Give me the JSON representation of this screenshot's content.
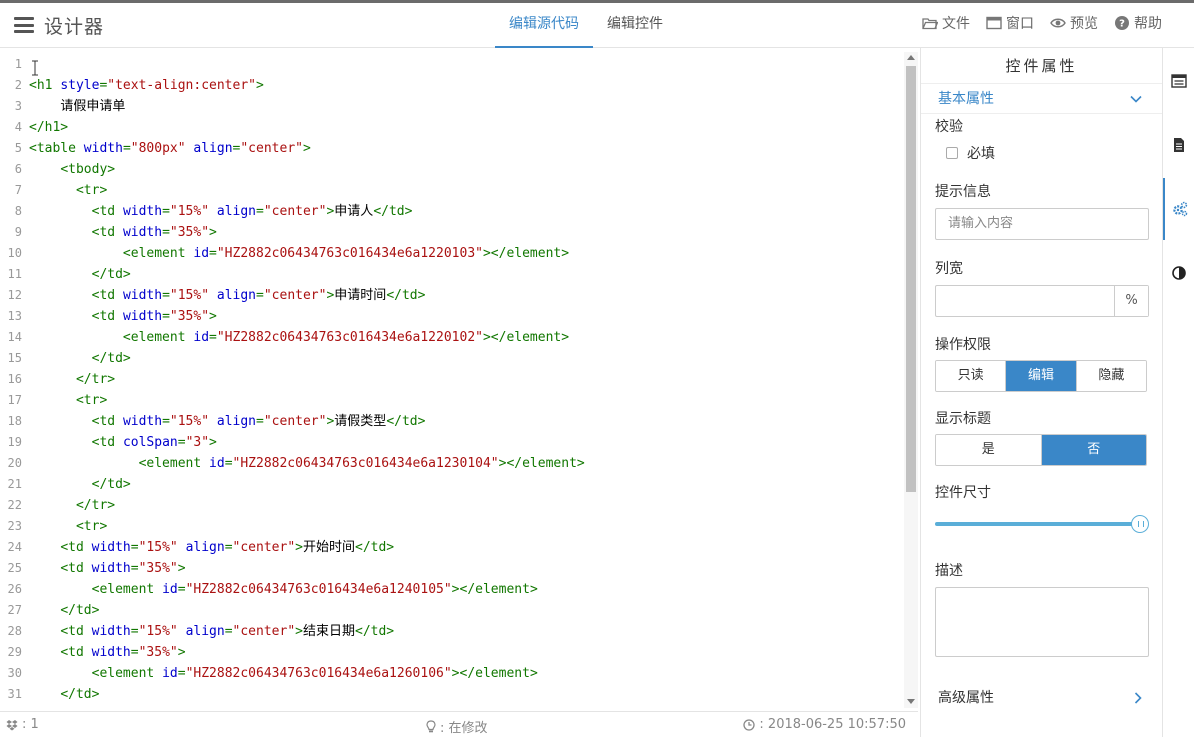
{
  "app": {
    "title": "设计器"
  },
  "tabs": [
    {
      "label": "编辑源代码",
      "active": true
    },
    {
      "label": "编辑控件",
      "active": false
    }
  ],
  "toolbar": {
    "file": "文件",
    "window": "窗口",
    "preview": "预览",
    "help": "帮助"
  },
  "editor": {
    "line_numbers": [
      "1",
      "2",
      "3",
      "4",
      "5",
      "6",
      "7",
      "8",
      "9",
      "10",
      "11",
      "12",
      "13",
      "14",
      "15",
      "16",
      "17",
      "18",
      "19",
      "20",
      "21",
      "22",
      "23",
      "24",
      "25",
      "26",
      "27",
      "28",
      "29",
      "30",
      "31"
    ],
    "lines": [
      {
        "indent": "",
        "tokens": []
      },
      {
        "indent": "",
        "tokens": [
          {
            "t": "tag",
            "v": "<h1"
          },
          {
            "t": "sp",
            "v": " "
          },
          {
            "t": "attr",
            "v": "style"
          },
          {
            "t": "tag",
            "v": "="
          },
          {
            "t": "str",
            "v": "\"text-align:center\""
          },
          {
            "t": "tag",
            "v": ">"
          }
        ]
      },
      {
        "indent": "    ",
        "tokens": [
          {
            "t": "txt",
            "v": "请假申请单"
          }
        ]
      },
      {
        "indent": "",
        "tokens": [
          {
            "t": "tag",
            "v": "</h1>"
          }
        ]
      },
      {
        "indent": "",
        "tokens": [
          {
            "t": "tag",
            "v": "<table"
          },
          {
            "t": "sp",
            "v": " "
          },
          {
            "t": "attr",
            "v": "width"
          },
          {
            "t": "tag",
            "v": "="
          },
          {
            "t": "str",
            "v": "\"800px\""
          },
          {
            "t": "sp",
            "v": " "
          },
          {
            "t": "attr",
            "v": "align"
          },
          {
            "t": "tag",
            "v": "="
          },
          {
            "t": "str",
            "v": "\"center\""
          },
          {
            "t": "tag",
            "v": ">"
          }
        ]
      },
      {
        "indent": "    ",
        "tokens": [
          {
            "t": "tag",
            "v": "<tbody>"
          }
        ]
      },
      {
        "indent": "      ",
        "tokens": [
          {
            "t": "tag",
            "v": "<tr>"
          }
        ]
      },
      {
        "indent": "        ",
        "tokens": [
          {
            "t": "tag",
            "v": "<td"
          },
          {
            "t": "sp",
            "v": " "
          },
          {
            "t": "attr",
            "v": "width"
          },
          {
            "t": "tag",
            "v": "="
          },
          {
            "t": "str",
            "v": "\"15%\""
          },
          {
            "t": "sp",
            "v": " "
          },
          {
            "t": "attr",
            "v": "align"
          },
          {
            "t": "tag",
            "v": "="
          },
          {
            "t": "str",
            "v": "\"center\""
          },
          {
            "t": "tag",
            "v": ">"
          },
          {
            "t": "txt",
            "v": "申请人"
          },
          {
            "t": "tag",
            "v": "</td>"
          }
        ]
      },
      {
        "indent": "        ",
        "tokens": [
          {
            "t": "tag",
            "v": "<td"
          },
          {
            "t": "sp",
            "v": " "
          },
          {
            "t": "attr",
            "v": "width"
          },
          {
            "t": "tag",
            "v": "="
          },
          {
            "t": "str",
            "v": "\"35%\""
          },
          {
            "t": "tag",
            "v": ">"
          }
        ]
      },
      {
        "indent": "            ",
        "tokens": [
          {
            "t": "tag",
            "v": "<element"
          },
          {
            "t": "sp",
            "v": " "
          },
          {
            "t": "attr",
            "v": "id"
          },
          {
            "t": "tag",
            "v": "="
          },
          {
            "t": "str",
            "v": "\"HZ2882c06434763c016434e6a1220103\""
          },
          {
            "t": "tag",
            "v": "></element>"
          }
        ]
      },
      {
        "indent": "        ",
        "tokens": [
          {
            "t": "tag",
            "v": "</td>"
          }
        ]
      },
      {
        "indent": "        ",
        "tokens": [
          {
            "t": "tag",
            "v": "<td"
          },
          {
            "t": "sp",
            "v": " "
          },
          {
            "t": "attr",
            "v": "width"
          },
          {
            "t": "tag",
            "v": "="
          },
          {
            "t": "str",
            "v": "\"15%\""
          },
          {
            "t": "sp",
            "v": " "
          },
          {
            "t": "attr",
            "v": "align"
          },
          {
            "t": "tag",
            "v": "="
          },
          {
            "t": "str",
            "v": "\"center\""
          },
          {
            "t": "tag",
            "v": ">"
          },
          {
            "t": "txt",
            "v": "申请时间"
          },
          {
            "t": "tag",
            "v": "</td>"
          }
        ]
      },
      {
        "indent": "        ",
        "tokens": [
          {
            "t": "tag",
            "v": "<td"
          },
          {
            "t": "sp",
            "v": " "
          },
          {
            "t": "attr",
            "v": "width"
          },
          {
            "t": "tag",
            "v": "="
          },
          {
            "t": "str",
            "v": "\"35%\""
          },
          {
            "t": "tag",
            "v": ">"
          }
        ]
      },
      {
        "indent": "            ",
        "tokens": [
          {
            "t": "tag",
            "v": "<element"
          },
          {
            "t": "sp",
            "v": " "
          },
          {
            "t": "attr",
            "v": "id"
          },
          {
            "t": "tag",
            "v": "="
          },
          {
            "t": "str",
            "v": "\"HZ2882c06434763c016434e6a1220102\""
          },
          {
            "t": "tag",
            "v": "></element>"
          }
        ]
      },
      {
        "indent": "        ",
        "tokens": [
          {
            "t": "tag",
            "v": "</td>"
          }
        ]
      },
      {
        "indent": "      ",
        "tokens": [
          {
            "t": "tag",
            "v": "</tr>"
          }
        ]
      },
      {
        "indent": "      ",
        "tokens": [
          {
            "t": "tag",
            "v": "<tr>"
          }
        ]
      },
      {
        "indent": "        ",
        "tokens": [
          {
            "t": "tag",
            "v": "<td"
          },
          {
            "t": "sp",
            "v": " "
          },
          {
            "t": "attr",
            "v": "width"
          },
          {
            "t": "tag",
            "v": "="
          },
          {
            "t": "str",
            "v": "\"15%\""
          },
          {
            "t": "sp",
            "v": " "
          },
          {
            "t": "attr",
            "v": "align"
          },
          {
            "t": "tag",
            "v": "="
          },
          {
            "t": "str",
            "v": "\"center\""
          },
          {
            "t": "tag",
            "v": ">"
          },
          {
            "t": "txt",
            "v": "请假类型"
          },
          {
            "t": "tag",
            "v": "</td>"
          }
        ]
      },
      {
        "indent": "        ",
        "tokens": [
          {
            "t": "tag",
            "v": "<td"
          },
          {
            "t": "sp",
            "v": " "
          },
          {
            "t": "attr",
            "v": "colSpan"
          },
          {
            "t": "tag",
            "v": "="
          },
          {
            "t": "str",
            "v": "\"3\""
          },
          {
            "t": "tag",
            "v": ">"
          }
        ]
      },
      {
        "indent": "              ",
        "tokens": [
          {
            "t": "tag",
            "v": "<element"
          },
          {
            "t": "sp",
            "v": " "
          },
          {
            "t": "attr",
            "v": "id"
          },
          {
            "t": "tag",
            "v": "="
          },
          {
            "t": "str",
            "v": "\"HZ2882c06434763c016434e6a1230104\""
          },
          {
            "t": "tag",
            "v": "></element>"
          }
        ]
      },
      {
        "indent": "        ",
        "tokens": [
          {
            "t": "tag",
            "v": "</td>"
          }
        ]
      },
      {
        "indent": "      ",
        "tokens": [
          {
            "t": "tag",
            "v": "</tr>"
          }
        ]
      },
      {
        "indent": "      ",
        "tokens": [
          {
            "t": "tag",
            "v": "<tr>"
          }
        ]
      },
      {
        "indent": "    ",
        "tokens": [
          {
            "t": "tag",
            "v": "<td"
          },
          {
            "t": "sp",
            "v": " "
          },
          {
            "t": "attr",
            "v": "width"
          },
          {
            "t": "tag",
            "v": "="
          },
          {
            "t": "str",
            "v": "\"15%\""
          },
          {
            "t": "sp",
            "v": " "
          },
          {
            "t": "attr",
            "v": "align"
          },
          {
            "t": "tag",
            "v": "="
          },
          {
            "t": "str",
            "v": "\"center\""
          },
          {
            "t": "tag",
            "v": ">"
          },
          {
            "t": "txt",
            "v": "开始时间"
          },
          {
            "t": "tag",
            "v": "</td>"
          }
        ]
      },
      {
        "indent": "    ",
        "tokens": [
          {
            "t": "tag",
            "v": "<td"
          },
          {
            "t": "sp",
            "v": " "
          },
          {
            "t": "attr",
            "v": "width"
          },
          {
            "t": "tag",
            "v": "="
          },
          {
            "t": "str",
            "v": "\"35%\""
          },
          {
            "t": "tag",
            "v": ">"
          }
        ]
      },
      {
        "indent": "        ",
        "tokens": [
          {
            "t": "tag",
            "v": "<element"
          },
          {
            "t": "sp",
            "v": " "
          },
          {
            "t": "attr",
            "v": "id"
          },
          {
            "t": "tag",
            "v": "="
          },
          {
            "t": "str",
            "v": "\"HZ2882c06434763c016434e6a1240105\""
          },
          {
            "t": "tag",
            "v": "></element>"
          }
        ]
      },
      {
        "indent": "    ",
        "tokens": [
          {
            "t": "tag",
            "v": "</td>"
          }
        ]
      },
      {
        "indent": "    ",
        "tokens": [
          {
            "t": "tag",
            "v": "<td"
          },
          {
            "t": "sp",
            "v": " "
          },
          {
            "t": "attr",
            "v": "width"
          },
          {
            "t": "tag",
            "v": "="
          },
          {
            "t": "str",
            "v": "\"15%\""
          },
          {
            "t": "sp",
            "v": " "
          },
          {
            "t": "attr",
            "v": "align"
          },
          {
            "t": "tag",
            "v": "="
          },
          {
            "t": "str",
            "v": "\"center\""
          },
          {
            "t": "tag",
            "v": ">"
          },
          {
            "t": "txt",
            "v": "结束日期"
          },
          {
            "t": "tag",
            "v": "</td>"
          }
        ]
      },
      {
        "indent": "    ",
        "tokens": [
          {
            "t": "tag",
            "v": "<td"
          },
          {
            "t": "sp",
            "v": " "
          },
          {
            "t": "attr",
            "v": "width"
          },
          {
            "t": "tag",
            "v": "="
          },
          {
            "t": "str",
            "v": "\"35%\""
          },
          {
            "t": "tag",
            "v": ">"
          }
        ]
      },
      {
        "indent": "        ",
        "tokens": [
          {
            "t": "tag",
            "v": "<element"
          },
          {
            "t": "sp",
            "v": " "
          },
          {
            "t": "attr",
            "v": "id"
          },
          {
            "t": "tag",
            "v": "="
          },
          {
            "t": "str",
            "v": "\"HZ2882c06434763c016434e6a1260106\""
          },
          {
            "t": "tag",
            "v": "></element>"
          }
        ]
      },
      {
        "indent": "    ",
        "tokens": [
          {
            "t": "tag",
            "v": "</td>"
          }
        ]
      }
    ],
    "colors": {
      "tag": "#117700",
      "attr": "#0000cc",
      "string": "#aa1111"
    }
  },
  "status": {
    "left": ": 1",
    "middle": ": 在修改",
    "right": ": 2018-06-25 10:57:50"
  },
  "props": {
    "title": "控件属性",
    "basic_section": "基本属性",
    "validate_label": "校验",
    "required_label": "必填",
    "required_checked": false,
    "hint_label": "提示信息",
    "hint_placeholder": "请输入内容",
    "width_label": "列宽",
    "width_value": "",
    "width_unit": "%",
    "perm_label": "操作权限",
    "perm_options": [
      "只读",
      "编辑",
      "隐藏"
    ],
    "perm_selected": "编辑",
    "showtitle_label": "显示标题",
    "showtitle_options": [
      "是",
      "否"
    ],
    "showtitle_selected": "否",
    "size_label": "控件尺寸",
    "size_level_fraction": 1.0,
    "desc_label": "描述",
    "desc_value": "",
    "advanced_section": "高级属性"
  },
  "rail": {
    "icons": [
      "list-panel-icon",
      "document-icon",
      "gears-icon",
      "contrast-icon"
    ],
    "active": "gears-icon"
  },
  "accent_color": "#3a87c8"
}
